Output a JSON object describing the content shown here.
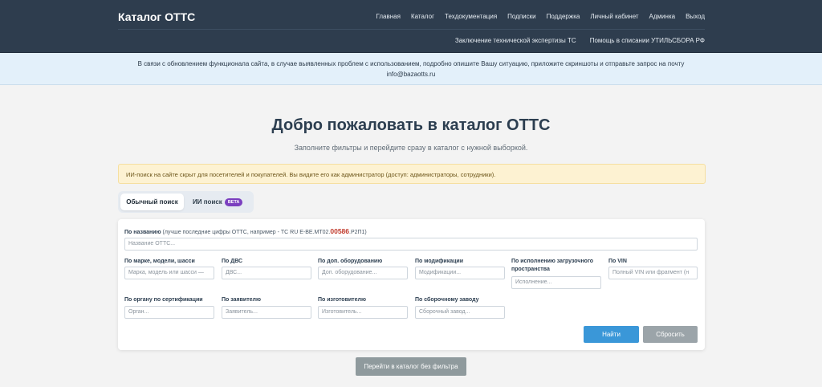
{
  "navbar": {
    "brand": "Каталог ОТТС",
    "menu_row1": [
      "Главная",
      "Каталог",
      "Техдокументация",
      "Подписки",
      "Поддержка",
      "Личный кабинет",
      "Админка",
      "Выход"
    ],
    "menu_row2": [
      "Заключение технической экспертизы ТС",
      "Помощь в списании УТИЛЬСБОРА РФ"
    ]
  },
  "notice": {
    "line1": "В связи с обновлением функционала сайта, в случае выявленных проблем с использованием, подробно опишите Вашу ситуацию, приложите скриншоты и отправьте запрос на почту",
    "line2": "info@bazaotts.ru"
  },
  "hero": {
    "title": "Добро пожаловать в каталог ОТТС",
    "subtitle": "Заполните фильтры и перейдите сразу в каталог с нужной выборкой."
  },
  "admin_warning": "ИИ-поиск на сайте скрыт для посетителей и покупателей. Вы видите его как администратор (доступ: администраторы, сотрудники).",
  "tabs": {
    "normal": "Обычный поиск",
    "ai": "ИИ поиск",
    "ai_badge": "BETA"
  },
  "filters": {
    "name": {
      "label": "По названию",
      "hint_prefix": "(лучше последние цифры ОТТС, например - ТС RU E-BE.MT02.",
      "hint_highlight": "00586",
      "hint_suffix": ".Р2П1)",
      "placeholder": "Название ОТТС..."
    },
    "brand": {
      "label": "По марке, модели, шасси",
      "placeholder": "Марка, модель или шасси —"
    },
    "engine": {
      "label": "По ДВС",
      "placeholder": "ДВС..."
    },
    "equipment": {
      "label": "По доп. оборудованию",
      "placeholder": "Доп. оборудование..."
    },
    "modification": {
      "label": "По модификации",
      "placeholder": "Модификации..."
    },
    "cargo": {
      "label": "По исполнению загрузочного пространства",
      "placeholder": "Исполнение..."
    },
    "vin": {
      "label": "По VIN",
      "placeholder": "Полный VIN или фрагмент (н"
    },
    "cert_body": {
      "label": "По органу по сертификации",
      "placeholder": "Орган..."
    },
    "applicant": {
      "label": "По заявителю",
      "placeholder": "Заявитель..."
    },
    "manufacturer": {
      "label": "По изготовителю",
      "placeholder": "Изготовитель..."
    },
    "plant": {
      "label": "По сборочному заводу",
      "placeholder": "Сборочный завод..."
    }
  },
  "buttons": {
    "find": "Найти",
    "reset": "Сбросить",
    "catalog_no_filter": "Перейти в каталог без фильтра"
  },
  "colors": {
    "navbar_bg": "#2e3d4e",
    "primary": "#3a97d8",
    "secondary": "#9ba4a9",
    "beta_badge": "#7b3fbf",
    "highlight_red": "#c0392b"
  }
}
